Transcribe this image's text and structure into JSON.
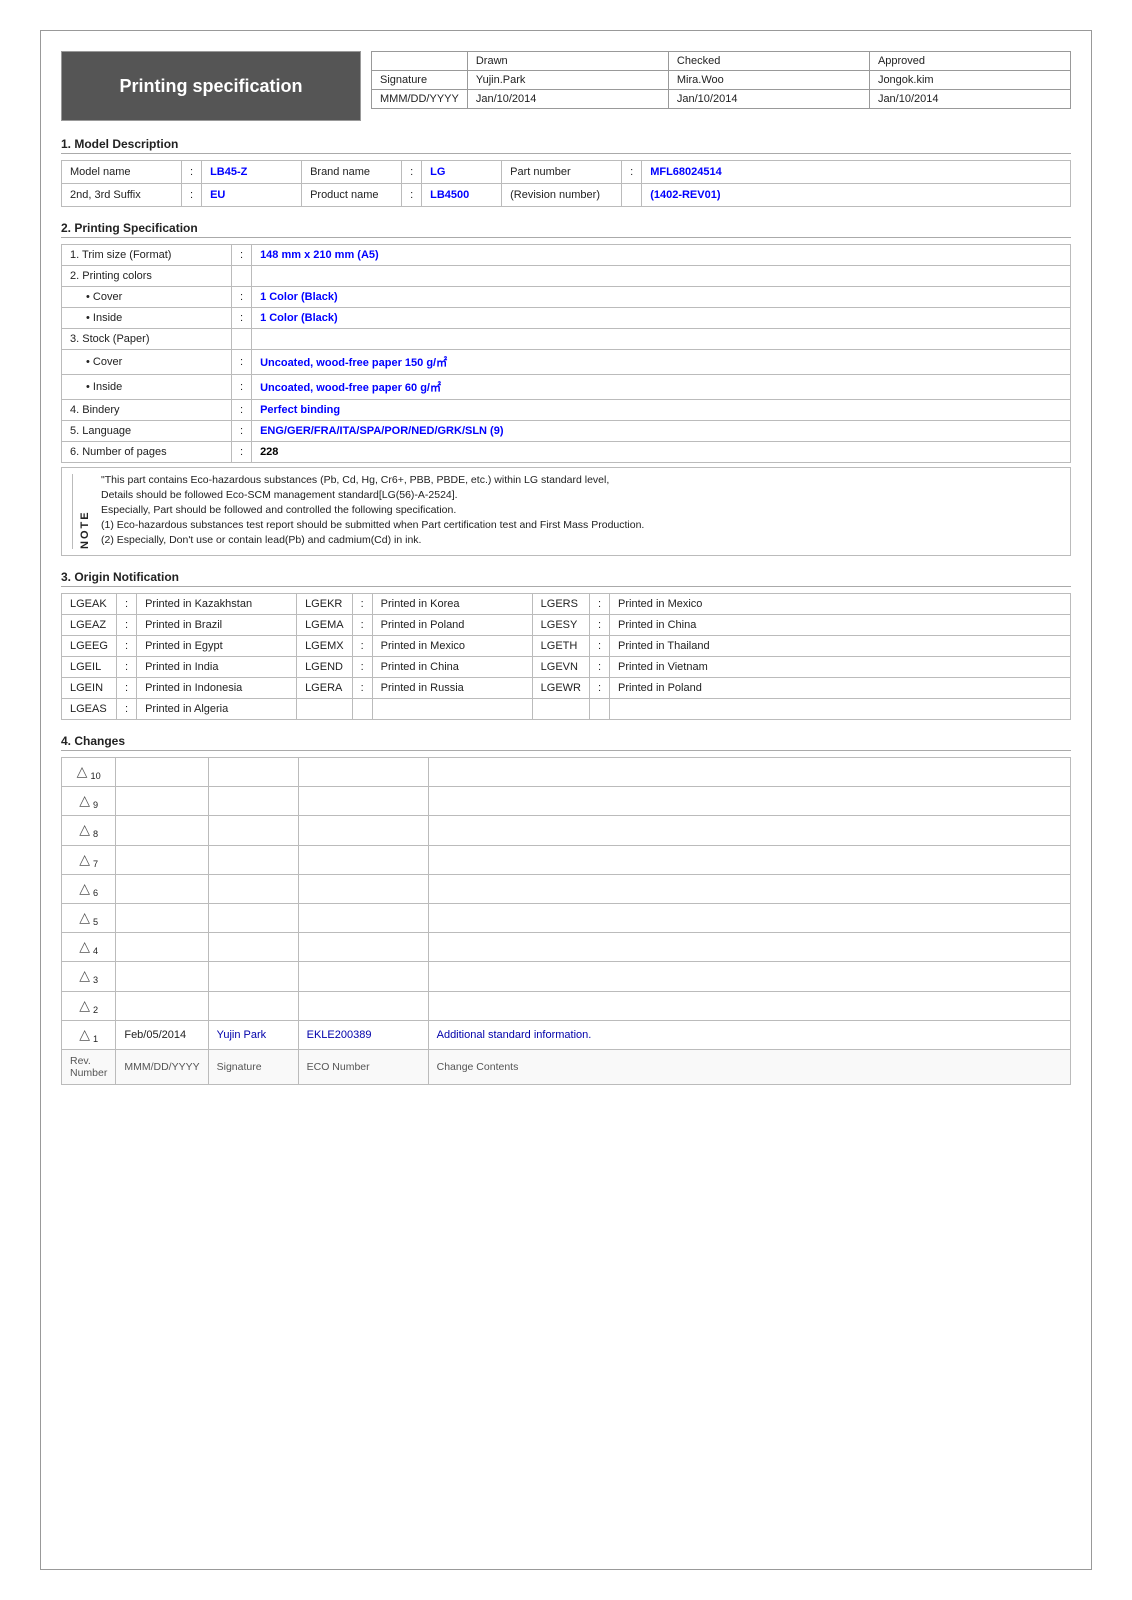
{
  "header": {
    "title": "Printing specification",
    "table": {
      "columns": [
        "",
        "Drawn",
        "Checked",
        "Approved"
      ],
      "rows": [
        [
          "Signature",
          "Yujin.Park",
          "Mira.Woo",
          "Jongok.kim"
        ],
        [
          "MMM/DD/YYYY",
          "Jan/10/2014",
          "Jan/10/2014",
          "Jan/10/2014"
        ]
      ]
    }
  },
  "sections": {
    "model_desc": {
      "heading": "1. Model Description",
      "rows": [
        {
          "label": "Model name",
          "sep": ":",
          "value": "LB45-Z",
          "label2": "Brand name",
          "sep2": ":",
          "value2": "LG",
          "label3": "Part number",
          "sep3": ":",
          "value3": "MFL68024514"
        },
        {
          "label": "2nd, 3rd Suffix",
          "sep": ":",
          "value": "EU",
          "label2": "Product name",
          "sep2": ":",
          "value2": "LB4500",
          "label3": "(Revision number)",
          "sep3": "",
          "value3": "(1402-REV01)"
        }
      ]
    },
    "printing_spec": {
      "heading": "2. Printing Specification",
      "items": [
        {
          "label": "1. Trim size (Format)",
          "sep": ":",
          "value": "148 mm x 210 mm (A5)",
          "bold": true
        },
        {
          "label": "2. Printing colors",
          "sep": "",
          "value": "",
          "bold": false
        },
        {
          "label": "• Cover",
          "sep": ":",
          "value": "1 Color (Black)",
          "bold": true,
          "indent": true
        },
        {
          "label": "• Inside",
          "sep": ":",
          "value": "1 Color (Black)",
          "bold": true,
          "indent": true
        },
        {
          "label": "3. Stock (Paper)",
          "sep": "",
          "value": "",
          "bold": false
        },
        {
          "label": "• Cover",
          "sep": ":",
          "value": "Uncoated, wood-free paper 150 g/㎡",
          "bold": true,
          "indent": true
        },
        {
          "label": "• Inside",
          "sep": ":",
          "value": "Uncoated, wood-free paper 60 g/㎡",
          "bold": true,
          "indent": true
        },
        {
          "label": "4. Bindery",
          "sep": ":",
          "value": "Perfect binding",
          "bold": true
        },
        {
          "label": "5. Language",
          "sep": ":",
          "value": "ENG/GER/FRA/ITA/SPA/POR/NED/GRK/SLN (9)",
          "bold": true
        },
        {
          "label": "6. Number of pages",
          "sep": ":",
          "value": "228",
          "bold": true
        }
      ],
      "notes": [
        "\"This part contains Eco-hazardous substances (Pb, Cd, Hg, Cr6+, PBB, PBDE, etc.) within LG standard level,",
        "Details should be followed Eco-SCM management standard[LG(56)-A-2524].",
        "Especially, Part should be followed and controlled the following specification.",
        "(1) Eco-hazardous substances test report should be submitted when Part certification test and First Mass Production.",
        "(2) Especially, Don't use or contain lead(Pb) and cadmium(Cd) in ink."
      ],
      "notes_side": "NOTE"
    },
    "origin": {
      "heading": "3. Origin Notification",
      "entries": [
        {
          "code": "LGEAK",
          "sep": ":",
          "text": "Printed in Kazakhstan",
          "code2": "LGEKR",
          "sep2": ":",
          "text2": "Printed in Korea",
          "code3": "LGERS",
          "sep3": ":",
          "text3": "Printed in Mexico"
        },
        {
          "code": "LGEAZ",
          "sep": ":",
          "text": "Printed in Brazil",
          "code2": "LGEMA",
          "sep2": ":",
          "text2": "Printed in Poland",
          "code3": "LGESY",
          "sep3": ":",
          "text3": "Printed in China"
        },
        {
          "code": "LGEEG",
          "sep": ":",
          "text": "Printed in Egypt",
          "code2": "LGEMX",
          "sep2": ":",
          "text2": "Printed in Mexico",
          "code3": "LGETH",
          "sep3": ":",
          "text3": "Printed in Thailand"
        },
        {
          "code": "LGEIL",
          "sep": ":",
          "text": "Printed in India",
          "code2": "LGEND",
          "sep2": ":",
          "text2": "Printed in China",
          "code3": "LGEVN",
          "sep3": ":",
          "text3": "Printed in Vietnam"
        },
        {
          "code": "LGEIN",
          "sep": ":",
          "text": "Printed in Indonesia",
          "code2": "LGERA",
          "sep2": ":",
          "text2": "Printed in Russia",
          "code3": "LGEWR",
          "sep3": ":",
          "text3": "Printed in Poland"
        },
        {
          "code": "LGEAS",
          "sep": ":",
          "text": "Printed in Algeria",
          "code2": "",
          "sep2": "",
          "text2": "",
          "code3": "",
          "sep3": "",
          "text3": ""
        }
      ]
    },
    "changes": {
      "heading": "4. Changes",
      "rows": [
        {
          "rev": "10",
          "date": "",
          "sig": "",
          "eco": "",
          "change": ""
        },
        {
          "rev": "9",
          "date": "",
          "sig": "",
          "eco": "",
          "change": ""
        },
        {
          "rev": "8",
          "date": "",
          "sig": "",
          "eco": "",
          "change": ""
        },
        {
          "rev": "7",
          "date": "",
          "sig": "",
          "eco": "",
          "change": ""
        },
        {
          "rev": "6",
          "date": "",
          "sig": "",
          "eco": "",
          "change": ""
        },
        {
          "rev": "5",
          "date": "",
          "sig": "",
          "eco": "",
          "change": ""
        },
        {
          "rev": "4",
          "date": "",
          "sig": "",
          "eco": "",
          "change": ""
        },
        {
          "rev": "3",
          "date": "",
          "sig": "",
          "eco": "",
          "change": ""
        },
        {
          "rev": "2",
          "date": "",
          "sig": "",
          "eco": "",
          "change": ""
        },
        {
          "rev": "1",
          "date": "Feb/05/2014",
          "sig": "Yujin Park",
          "eco": "EKLE200389",
          "change": "Additional standard information."
        }
      ],
      "footer": {
        "rev": "Rev. Number",
        "date": "MMM/DD/YYYY",
        "sig": "Signature",
        "eco": "ECO Number",
        "change": "Change Contents"
      }
    }
  }
}
